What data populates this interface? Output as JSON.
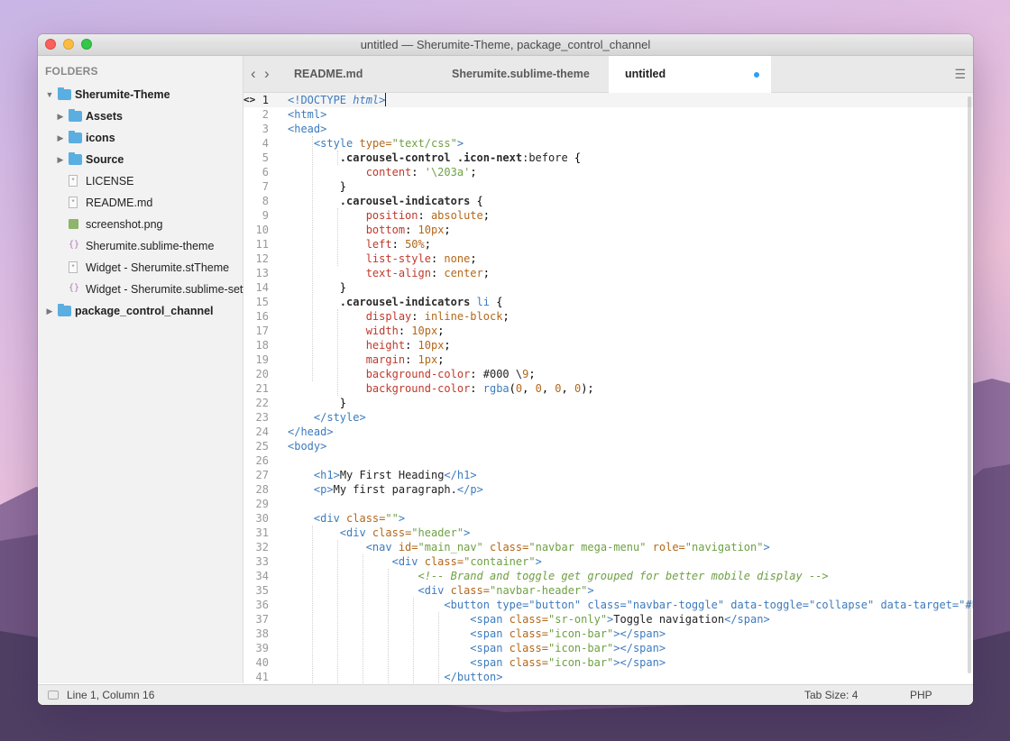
{
  "window": {
    "title": "untitled — Sherumite-Theme, package_control_channel"
  },
  "sidebar": {
    "header": "FOLDERS",
    "items": [
      {
        "label": "Sherumite-Theme",
        "type": "folder",
        "level": 0,
        "expanded": true,
        "bold": true
      },
      {
        "label": "Assets",
        "type": "folder",
        "level": 1,
        "expanded": false,
        "bold": true
      },
      {
        "label": "icons",
        "type": "folder",
        "level": 1,
        "expanded": false,
        "bold": true
      },
      {
        "label": "Source",
        "type": "folder",
        "level": 1,
        "expanded": false,
        "bold": true
      },
      {
        "label": "LICENSE",
        "type": "text-file",
        "level": 1
      },
      {
        "label": "README.md",
        "type": "text-file",
        "level": 1
      },
      {
        "label": "screenshot.png",
        "type": "image-file",
        "level": 1
      },
      {
        "label": "Sherumite.sublime-theme",
        "type": "json-file",
        "level": 1
      },
      {
        "label": "Widget - Sherumite.stTheme",
        "type": "text-file",
        "level": 1
      },
      {
        "label": "Widget - Sherumite.sublime-sett",
        "type": "json-file",
        "level": 1
      },
      {
        "label": "package_control_channel",
        "type": "folder",
        "level": 0,
        "expanded": false,
        "bold": true
      }
    ]
  },
  "tabs": [
    {
      "label": "README.md",
      "active": false
    },
    {
      "label": "Sherumite.sublime-theme",
      "active": false
    },
    {
      "label": "untitled",
      "active": true,
      "dirty": true
    }
  ],
  "nav": {
    "back": "‹",
    "forward": "›"
  },
  "editor": {
    "current_line": 1,
    "lines": [
      "<!DOCTYPE html>",
      "<html>",
      "<head>",
      "    <style type=\"text/css\">",
      "        .carousel-control .icon-next:before {",
      "            content: '\\203a';",
      "        }",
      "        .carousel-indicators {",
      "            position: absolute;",
      "            bottom: 10px;",
      "            left: 50%;",
      "            list-style: none;",
      "            text-align: center;",
      "        }",
      "        .carousel-indicators li {",
      "            display: inline-block;",
      "            width: 10px;",
      "            height: 10px;",
      "            margin: 1px;",
      "            background-color: #000 \\9;",
      "            background-color: rgba(0, 0, 0, 0);",
      "        }",
      "    </style>",
      "</head>",
      "<body>",
      "",
      "    <h1>My First Heading</h1>",
      "    <p>My first paragraph.</p>",
      "",
      "    <div class=\"\">",
      "        <div class=\"header\">",
      "            <nav id=\"main_nav\" class=\"navbar mega-menu\" role=\"navigation\">",
      "                <div class=\"container\">",
      "                    <!-- Brand and toggle get grouped for better mobile display -->",
      "                    <div class=\"navbar-header\">",
      "                        <button type=\"button\" class=\"navbar-toggle\" data-toggle=\"collapse\" data-target=\"#bs-e",
      "                            <span class=\"sr-only\">Toggle navigation</span>",
      "                            <span class=\"icon-bar\"></span>",
      "                            <span class=\"icon-bar\"></span>",
      "                            <span class=\"icon-bar\"></span>",
      "                        </button>"
    ]
  },
  "status": {
    "position": "Line 1, Column 16",
    "tab_size": "Tab Size: 4",
    "syntax": "PHP"
  },
  "colors": {
    "tag": "#3d7bbd",
    "attribute": "#b3671a",
    "string": "#6fa043",
    "property": "#c0392b",
    "dirty_dot": "#2d9ef0",
    "folder": "#5aaee0"
  }
}
